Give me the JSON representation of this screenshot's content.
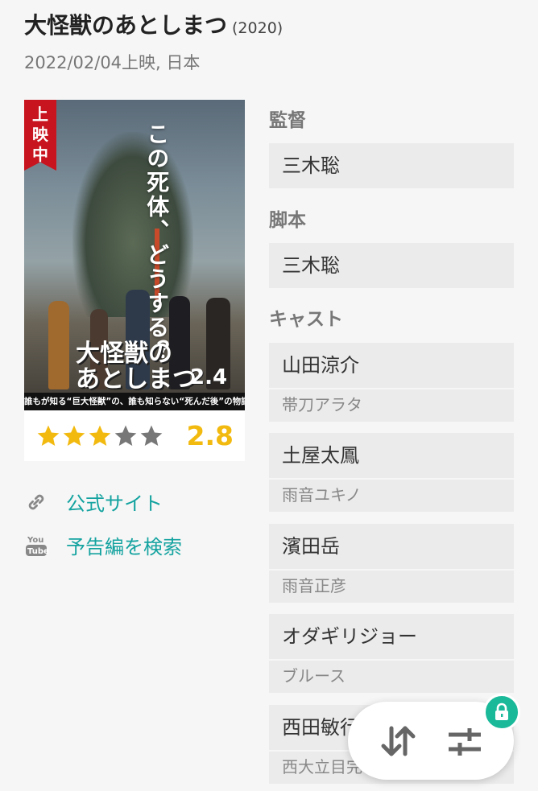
{
  "movie": {
    "title": "大怪獣のあとしまつ",
    "year": "(2020)",
    "release": "2022/02/04上映, 日本"
  },
  "poster": {
    "badge": [
      "上",
      "映",
      "中"
    ],
    "catchphrase": "この死体、どうする？",
    "logo_line1": "大怪獣の",
    "logo_line2": "あとしまつ",
    "date": "2.4",
    "tagline": "誰もが知る“巨大怪獣”の、誰も知らない“死んだ後”の物語。"
  },
  "rating": {
    "value": "2.8",
    "stars_filled": 3,
    "stars_total": 5,
    "star_color": "#f2b90f",
    "star_empty_color": "#777777"
  },
  "links": {
    "official": {
      "label": "公式サイト",
      "icon": "link-icon"
    },
    "trailer": {
      "label": "予告編を検索",
      "icon": "youtube-icon"
    },
    "accent_color": "#14a3a0"
  },
  "director": {
    "label": "監督",
    "name": "三木聡"
  },
  "writer": {
    "label": "脚本",
    "name": "三木聡"
  },
  "cast": {
    "label": "キャスト",
    "members": [
      {
        "name": "山田涼介",
        "role": "帯刀アラタ"
      },
      {
        "name": "土屋太鳳",
        "role": "雨音ユキノ"
      },
      {
        "name": "濱田岳",
        "role": "雨音正彦"
      },
      {
        "name": "オダギリジョー",
        "role": "ブルース"
      },
      {
        "name": "西田敏行",
        "role": "西大立目完"
      }
    ]
  },
  "fab": {
    "sort_icon": "sort-icon",
    "filter_icon": "filter-icon",
    "lock_icon": "lock-icon",
    "lock_color": "#19b99a"
  }
}
